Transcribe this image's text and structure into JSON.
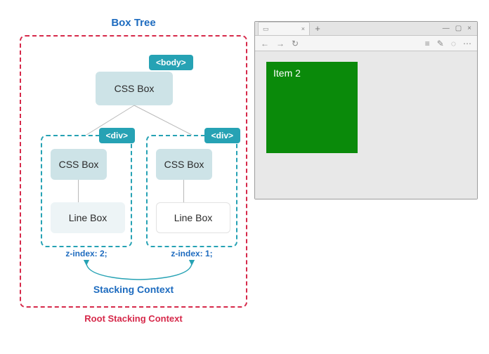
{
  "diagram": {
    "title": "Box Tree",
    "root_stack_label": "Root Stacking Context",
    "stacking_context_label": "Stacking Context",
    "root": {
      "tag": "<body>",
      "box_label": "CSS Box"
    },
    "children": [
      {
        "tag": "<div>",
        "css_box_label": "CSS Box",
        "line_box_label": "Line Box",
        "line_box_style": "pale",
        "z_index_label": "z-index: 2;"
      },
      {
        "tag": "<div>",
        "css_box_label": "CSS Box",
        "line_box_label": "Line Box",
        "line_box_style": "white",
        "z_index_label": "z-index: 1;"
      }
    ]
  },
  "browser": {
    "tab_close_glyph": "×",
    "new_tab_glyph": "+",
    "window_controls": {
      "min": "—",
      "max": "▢",
      "close": "×"
    },
    "toolbar": {
      "back": "←",
      "forward": "→",
      "reload": "↻",
      "menu": "≡",
      "edit": "✎",
      "loading": "◌",
      "more": "⋯"
    },
    "viewport": {
      "item_label": "Item 2",
      "item_bg_color": "#0a8a0a"
    }
  },
  "colors": {
    "accent_blue": "#1d6bbf",
    "accent_teal": "#26a2b4",
    "accent_red": "#d6294a"
  }
}
